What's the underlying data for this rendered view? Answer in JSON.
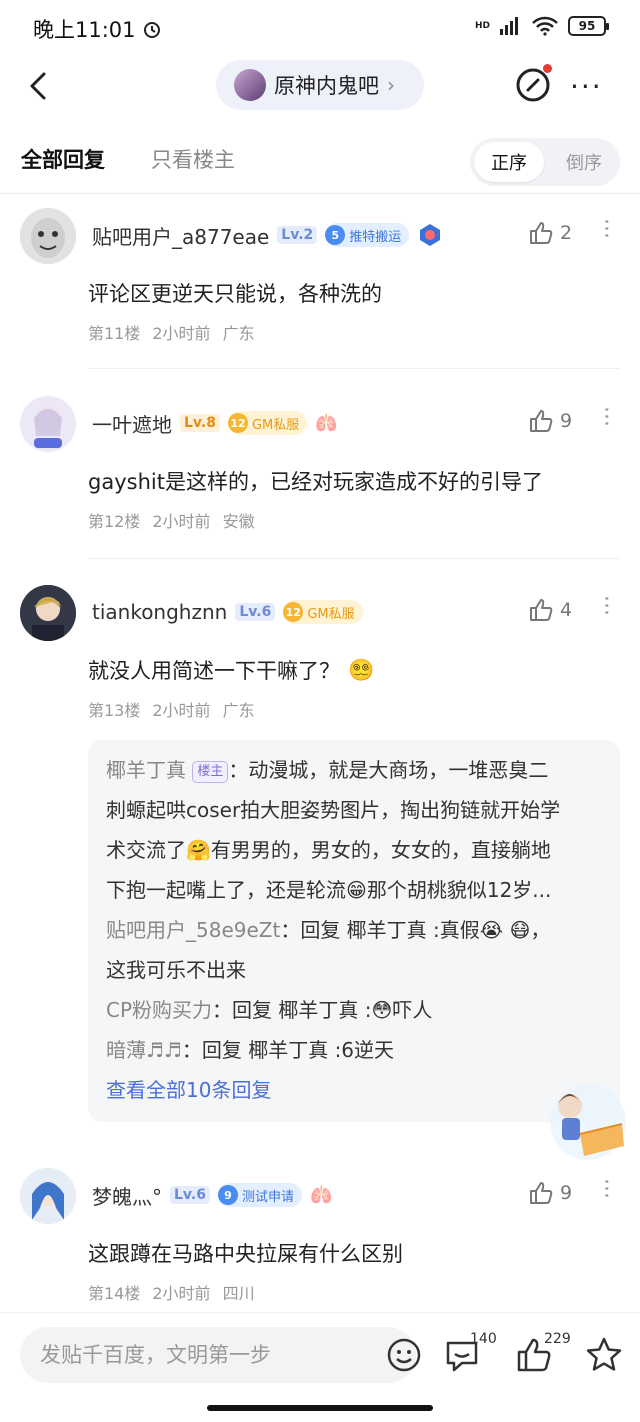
{
  "status_bar": {
    "time": "晚上11:01",
    "battery": "95",
    "network": "HD"
  },
  "nav": {
    "forum_name": "原神内鬼吧"
  },
  "tabs": {
    "all": "全部回复",
    "owner_only": "只看楼主",
    "order_asc": "正序",
    "order_desc": "倒序"
  },
  "posts": [
    {
      "username": "贴吧用户_a877eae",
      "level": "Lv.2",
      "badge_num": "5",
      "badge_text": "推特搬运",
      "likes": "2",
      "content": "评论区更逆天只能说，各种洗的",
      "floor": "第11楼",
      "time": "2小时前",
      "location": "广东"
    },
    {
      "username": "一叶遮地",
      "level": "Lv.8",
      "badge_num": "12",
      "badge_text": "GM私服",
      "likes": "9",
      "content": "gayshit是这样的，已经对玩家造成不好的引导了",
      "floor": "第12楼",
      "time": "2小时前",
      "location": "安徽"
    },
    {
      "username": "tiankonghznn",
      "level": "Lv.6",
      "badge_num": "12",
      "badge_text": "GM私服",
      "likes": "4",
      "content": "就没人用简述一下干嘛了？",
      "floor": "第13楼",
      "time": "2小时前",
      "location": "广东"
    },
    {
      "username": "梦魄灬°",
      "level": "Lv.6",
      "badge_num": "9",
      "badge_text": "测试申请",
      "likes": "9",
      "content": "这跟蹲在马路中央拉屎有什么区别",
      "floor": "第14楼",
      "time": "2小时前",
      "location": "四川"
    }
  ],
  "replies": {
    "r1_name": "椰羊丁真",
    "r1_tag": "楼主",
    "r1_text_a": "：动漫城，就是大商场，一堆恶臭二",
    "r1_text_b": "刺螈起哄coser拍大胆姿势图片，掏出狗链就开始学",
    "r1_text_c": "术交流了",
    "r1_text_c2": "有男男的，男女的，女女的，直接躺地",
    "r1_text_d": "下抱一起嘴上了，还是轮流",
    "r1_text_d2": "那个胡桃貌似12岁...",
    "r2_name": "贴吧用户_58e9eZt",
    "r2_text_a": "：回复 椰羊丁真 :真假",
    "r2_text_a2": "，",
    "r2_text_b": "这我可乐不出来",
    "r3_name": "CP粉购买力",
    "r3_text_a": "：回复 椰羊丁真 :",
    "r3_text_a2": "吓人",
    "r4_name": "暗薄♬♬",
    "r4_text": "：回复 椰羊丁真 :6逆天",
    "view_all": "查看全部10条回复"
  },
  "bottom_bar": {
    "input_placeholder": "发贴千百度，文明第一步",
    "comment_count": "140",
    "like_count": "229"
  }
}
